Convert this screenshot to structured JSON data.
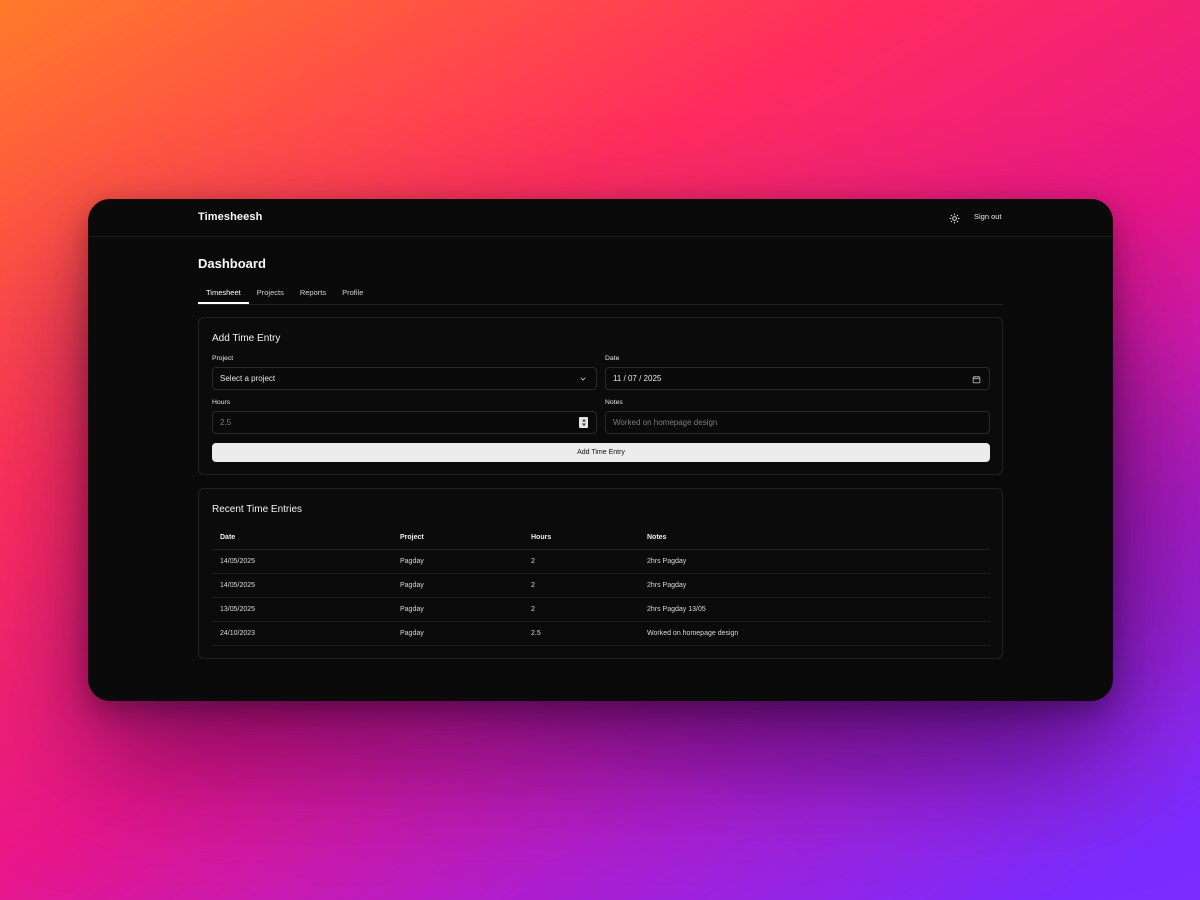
{
  "app": {
    "brand": "Timesheesh",
    "sign_out": "Sign out",
    "theme_icon": "sun-icon"
  },
  "page": {
    "title": "Dashboard"
  },
  "tabs": [
    {
      "label": "Timesheet",
      "active": true
    },
    {
      "label": "Projects",
      "active": false
    },
    {
      "label": "Reports",
      "active": false
    },
    {
      "label": "Profile",
      "active": false
    }
  ],
  "form": {
    "title": "Add Time Entry",
    "project": {
      "label": "Project",
      "value": "Select a project"
    },
    "date": {
      "label": "Date",
      "value": "11 / 07 / 2025"
    },
    "hours": {
      "label": "Hours",
      "placeholder": "2.5"
    },
    "notes": {
      "label": "Notes",
      "placeholder": "Worked on homepage design"
    },
    "submit_label": "Add Time Entry"
  },
  "recent": {
    "title": "Recent Time Entries",
    "columns": [
      "Date",
      "Project",
      "Hours",
      "Notes"
    ],
    "rows": [
      [
        "14/05/2025",
        "Pagday",
        "2",
        "2hrs Pagday"
      ],
      [
        "14/05/2025",
        "Pagday",
        "2",
        "2hrs Pagday"
      ],
      [
        "13/05/2025",
        "Pagday",
        "2",
        "2hrs Pagday 13/05"
      ],
      [
        "24/10/2023",
        "Pagday",
        "2.5",
        "Worked on homepage design"
      ]
    ]
  },
  "colors": {
    "window_bg": "#0a0a0a",
    "button_bg": "#ececec",
    "accent": "#ffffff"
  }
}
